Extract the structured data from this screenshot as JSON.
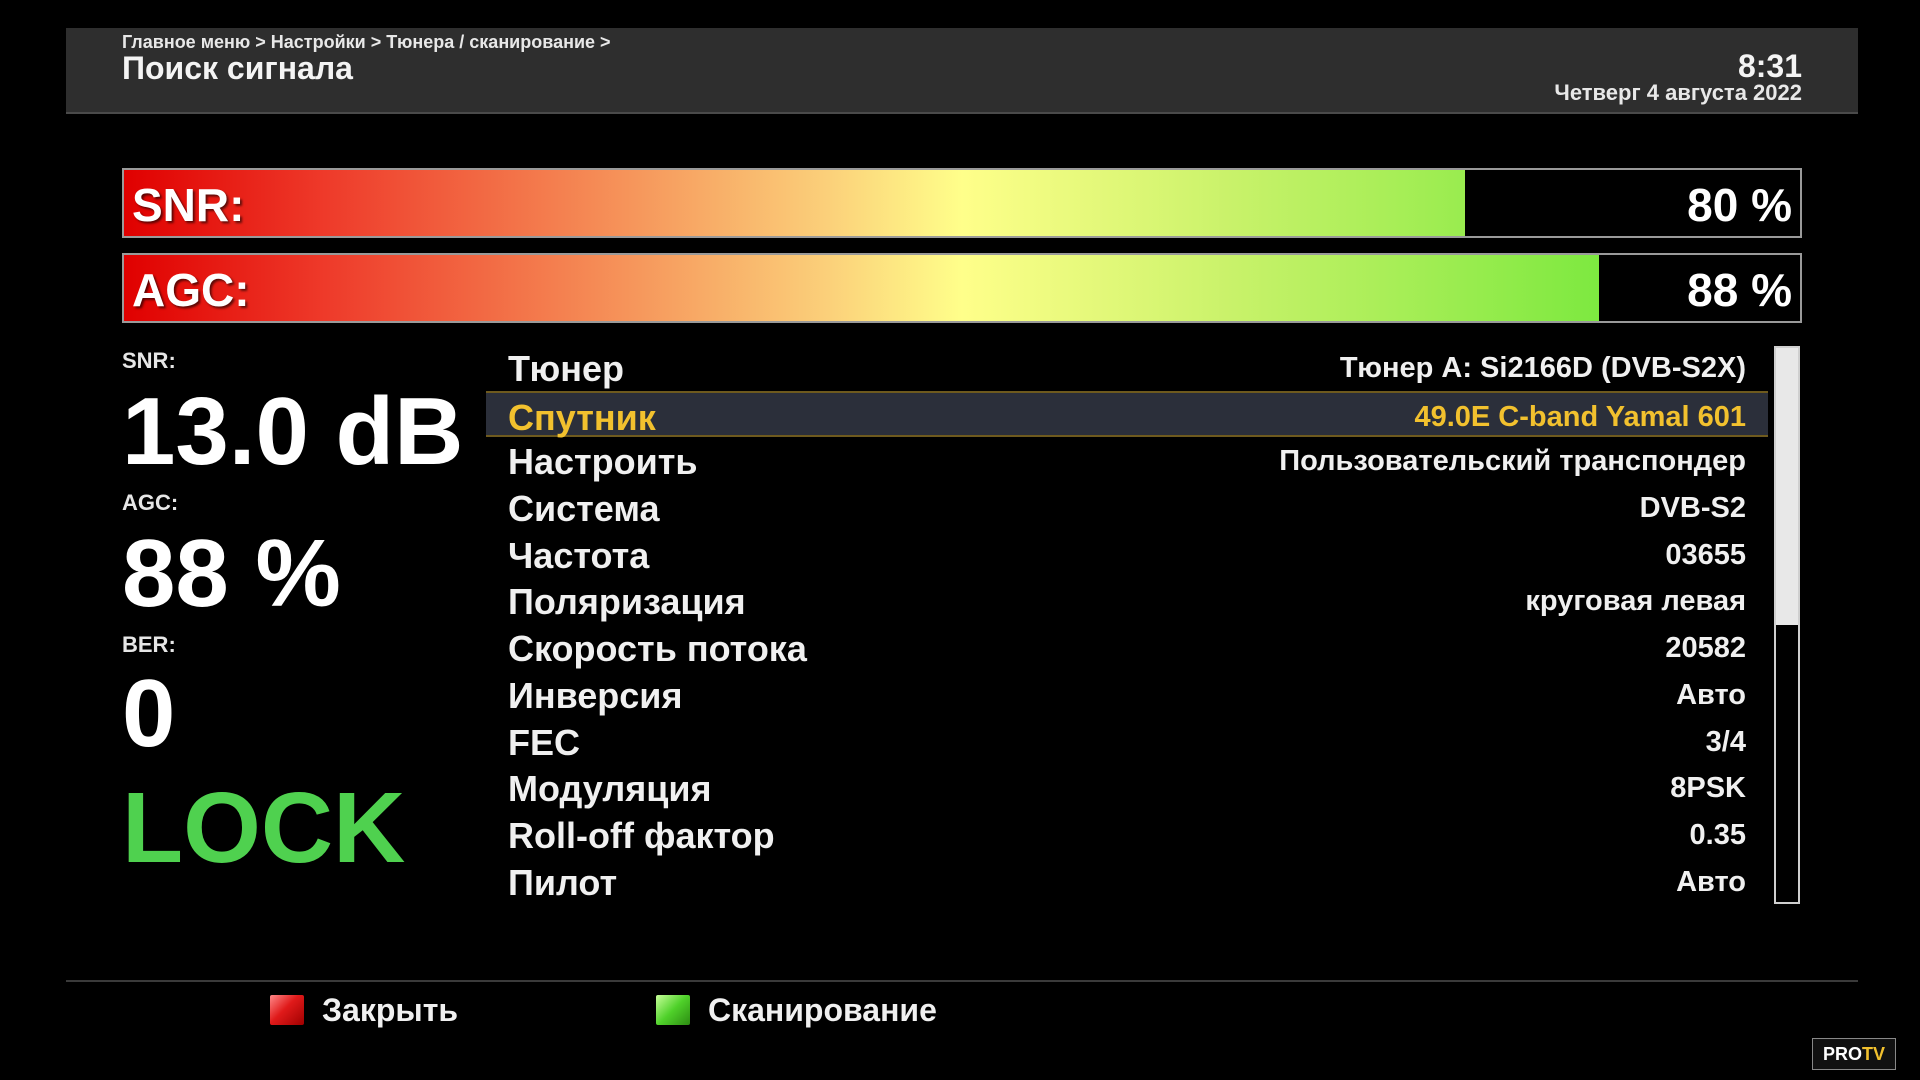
{
  "header": {
    "breadcrumb": "Главное меню > Настройки > Тюнера / сканирование >",
    "title": "Поиск сигнала",
    "time": "8:31",
    "date": "Четверг  4 августа 2022"
  },
  "meters": [
    {
      "label": "SNR:",
      "value_text": "80 %",
      "percent": 80
    },
    {
      "label": "AGC:",
      "value_text": "88 %",
      "percent": 88
    }
  ],
  "readouts": {
    "snr_label": "SNR:",
    "snr_value": "13.0 dB",
    "agc_label": "AGC:",
    "agc_value": "88 %",
    "ber_label": "BER:",
    "ber_value": "0",
    "lock_status": "LOCK"
  },
  "params": [
    {
      "label": "Тюнер",
      "value": "Тюнер A: Si2166D (DVB-S2X)",
      "selected": false
    },
    {
      "label": "Спутник",
      "value": "49.0E C-band Yamal 601",
      "selected": true
    },
    {
      "label": "Настроить",
      "value": "Пользовательский транспондер",
      "selected": false
    },
    {
      "label": "Система",
      "value": "DVB-S2",
      "selected": false
    },
    {
      "label": "Частота",
      "value": "03655",
      "selected": false
    },
    {
      "label": "Поляризация",
      "value": "круговая левая",
      "selected": false
    },
    {
      "label": "Скорость потока",
      "value": "20582",
      "selected": false
    },
    {
      "label": "Инверсия",
      "value": "Авто",
      "selected": false
    },
    {
      "label": "FEC",
      "value": "3/4",
      "selected": false
    },
    {
      "label": "Модуляция",
      "value": "8PSK",
      "selected": false
    },
    {
      "label": "Roll-off фактор",
      "value": "0.35",
      "selected": false
    },
    {
      "label": "Пилот",
      "value": "Авто",
      "selected": false
    }
  ],
  "scrollbar": {
    "thumb_fraction": 0.5
  },
  "footer": {
    "close_label": "Закрыть",
    "scan_label": "Сканирование"
  },
  "logo": {
    "text_main": "PRO",
    "text_accent": "TV"
  },
  "colors": {
    "selected_text": "#f2c12e",
    "lock_green": "#4fd14f"
  }
}
